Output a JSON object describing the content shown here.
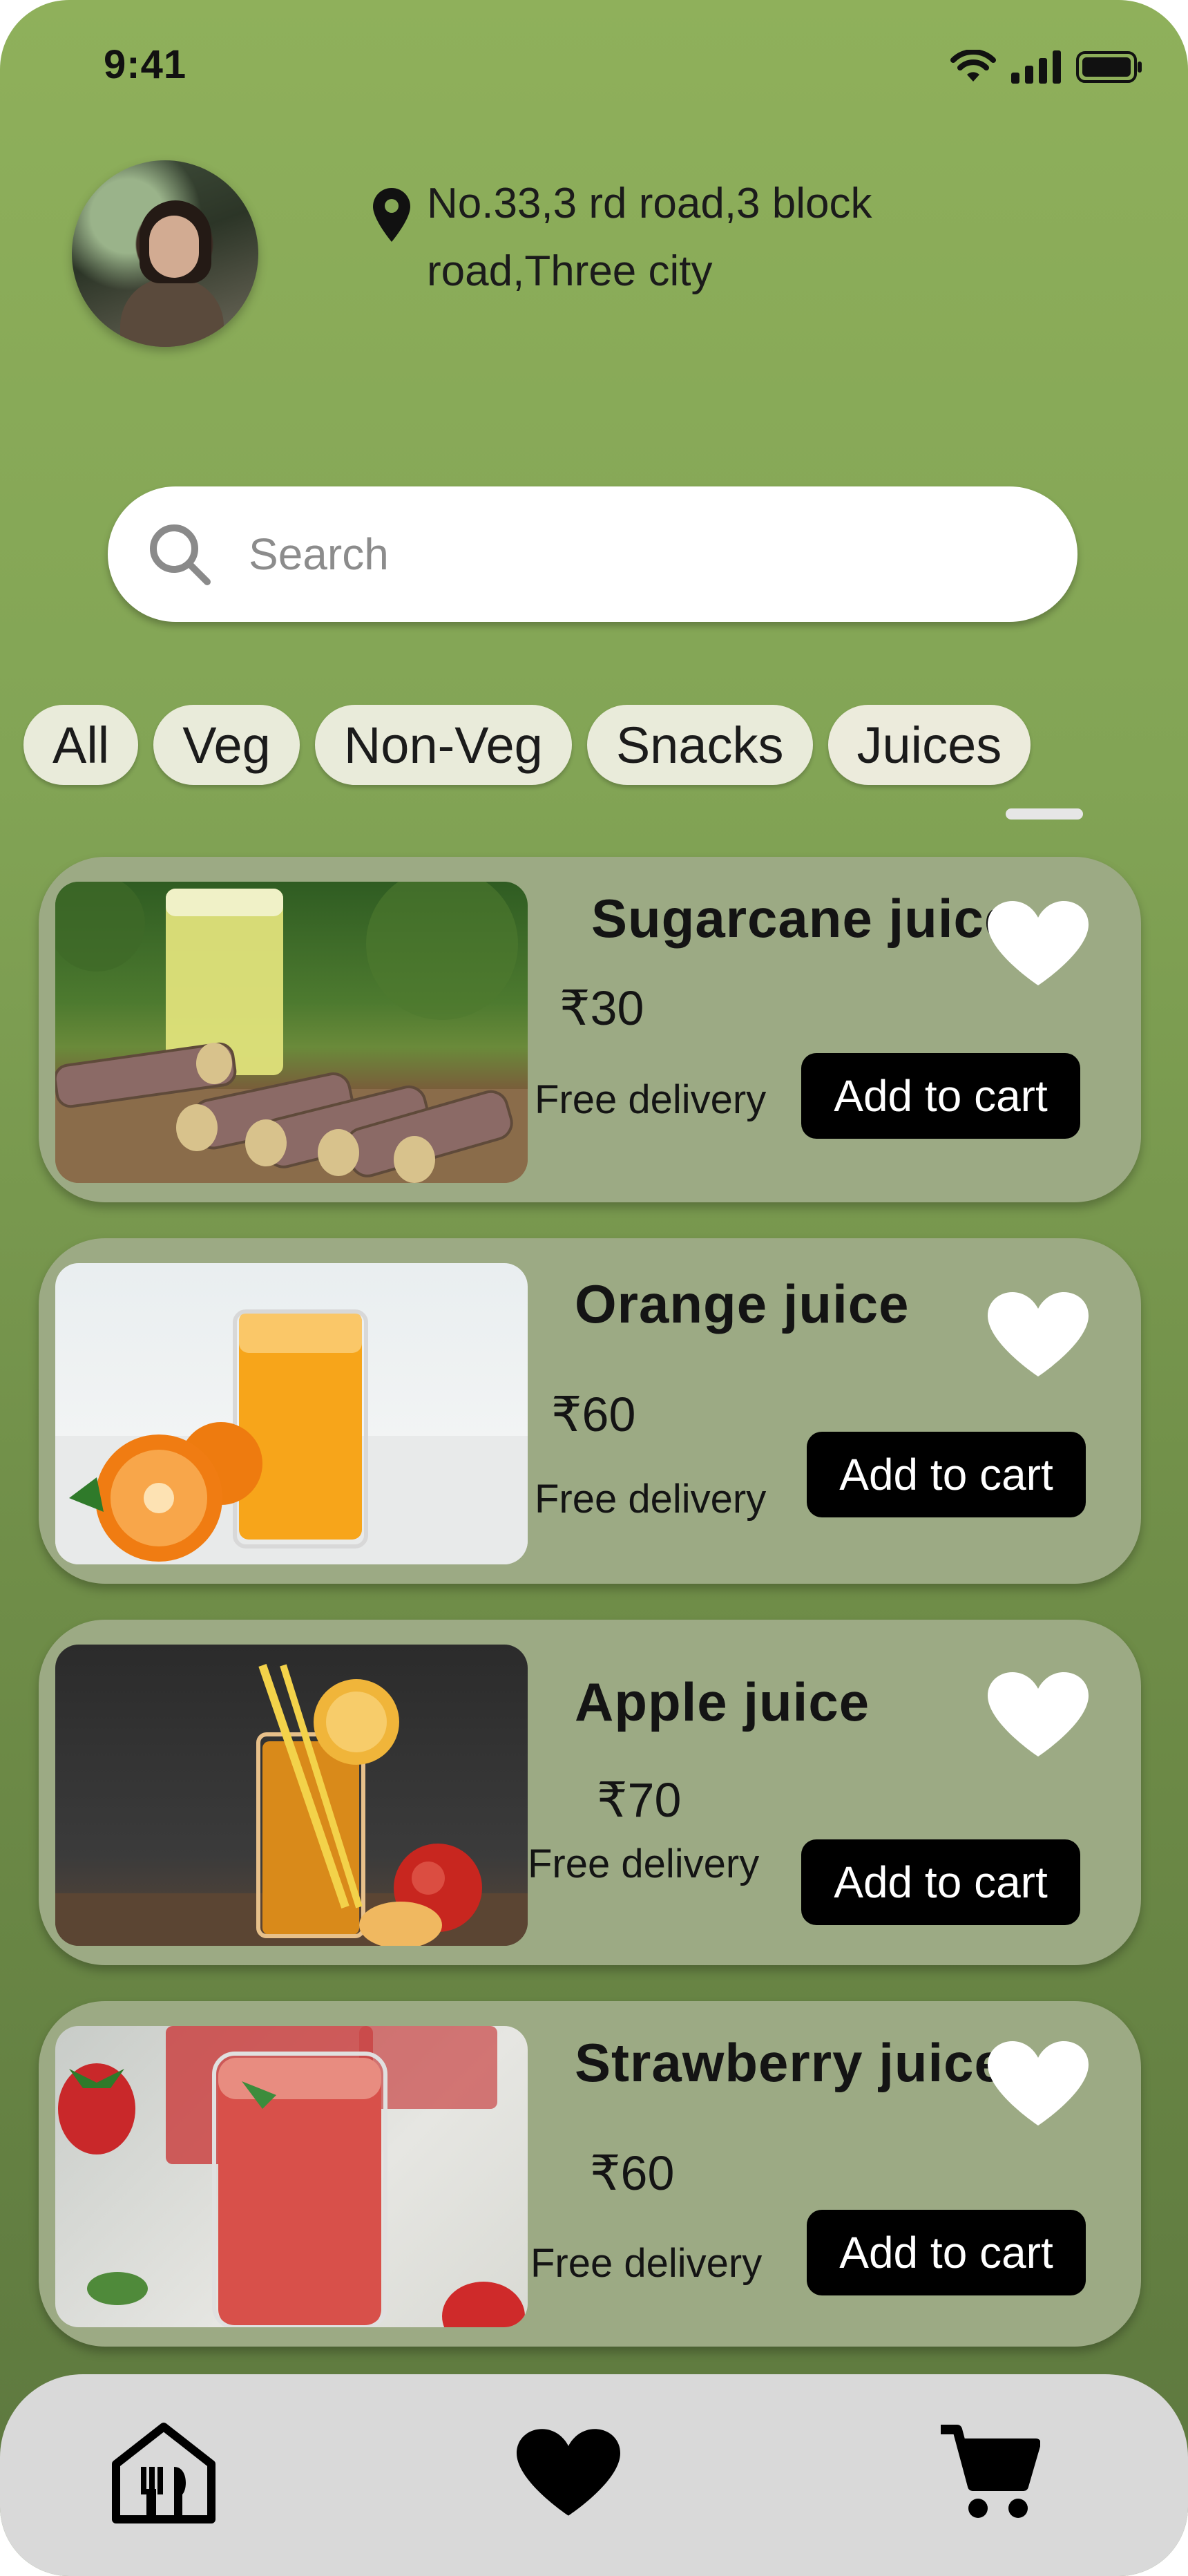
{
  "status_bar": {
    "time": "9:41",
    "icons": [
      "wifi-icon",
      "signal-icon",
      "battery-icon"
    ]
  },
  "header": {
    "avatar": "user-avatar",
    "location_icon": "location-pin-icon",
    "address": "No.33,3 rd road,3 block road,Three city"
  },
  "search": {
    "placeholder": "Search",
    "value": "",
    "icon": "search-icon"
  },
  "categories": {
    "items": [
      {
        "label": "All"
      },
      {
        "label": "Veg"
      },
      {
        "label": "Non-Veg"
      },
      {
        "label": "Snacks"
      },
      {
        "label": "Juices"
      }
    ],
    "selected": "Juices"
  },
  "products": [
    {
      "name": "Sugarcane juice",
      "price": "₹30",
      "delivery": "Free delivery",
      "cart_label": "Add to cart",
      "favorite": true,
      "image": "sugarcane-juice-photo"
    },
    {
      "name": "Orange juice",
      "price": "₹60",
      "delivery": "Free delivery",
      "cart_label": "Add to cart",
      "favorite": true,
      "image": "orange-juice-photo"
    },
    {
      "name": "Apple juice",
      "price": "₹70",
      "delivery": "Free delivery",
      "cart_label": "Add to cart",
      "favorite": true,
      "image": "apple-juice-photo"
    },
    {
      "name": "Strawberry juice",
      "price": "₹60",
      "delivery": "Free delivery",
      "cart_label": "Add to cart",
      "favorite": true,
      "image": "strawberry-juice-photo"
    }
  ],
  "bottom_nav": {
    "items": [
      "home-restaurant-icon",
      "heart-icon",
      "cart-icon"
    ]
  },
  "colors": {
    "background_top": "#8fb05b",
    "background_bottom": "#5c773e",
    "card": "#9caa84",
    "chip": "#e9ebda",
    "button": "#000000",
    "nav": "#d9d9d9"
  }
}
